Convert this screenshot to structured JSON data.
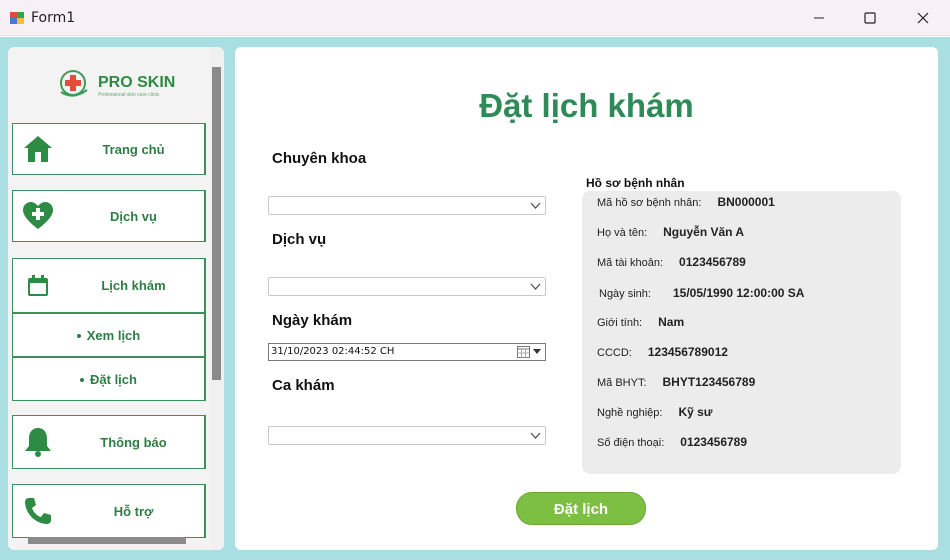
{
  "window": {
    "title": "Form1"
  },
  "logo": {
    "name": "PRO SKIN",
    "tagline": "Professional skin care clinic"
  },
  "sidebar": {
    "items": [
      {
        "label": "Trang chủ",
        "icon": "home-icon"
      },
      {
        "label": "Dịch vụ",
        "icon": "heart-plus-icon"
      },
      {
        "label": "Lịch khám",
        "icon": "calendar-icon"
      },
      {
        "label": "Xem lịch",
        "icon": ""
      },
      {
        "label": "Đặt lịch",
        "icon": ""
      },
      {
        "label": "Thông báo",
        "icon": "bell-icon"
      },
      {
        "label": "Hỗ trợ",
        "icon": "phone-icon"
      }
    ]
  },
  "main": {
    "title": "Đặt lịch khám",
    "fields": {
      "specialty_label": "Chuyên khoa",
      "specialty_value": "",
      "service_label": "Dịch vụ",
      "service_value": "",
      "date_label": "Ngày khám",
      "date_value": "31/10/2023 02:44:52 CH",
      "shift_label": "Ca khám",
      "shift_value": ""
    },
    "submit_label": "Đặt lịch"
  },
  "profile": {
    "heading": "Hồ sơ bệnh nhân",
    "rows": [
      {
        "key": "Mã hồ sơ bệnh nhân:",
        "value": "BN000001"
      },
      {
        "key": "Họ và tên:",
        "value": "Nguyễn Văn A"
      },
      {
        "key": "Mã tài khoản:",
        "value": "0123456789"
      },
      {
        "key": "Ngày sinh:",
        "value": "15/05/1990 12:00:00 SA"
      },
      {
        "key": "Giới tính:",
        "value": "Nam"
      },
      {
        "key": "CCCD:",
        "value": "123456789012"
      },
      {
        "key": "Mã BHYT:",
        "value": "BHYT123456789"
      },
      {
        "key": "Nghề nghiệp:",
        "value": "Kỹ sư"
      },
      {
        "key": "Số điện thoại:",
        "value": "0123456789"
      }
    ]
  },
  "colors": {
    "accent_green": "#2e8b57",
    "button_green": "#7cbf43",
    "frame_teal": "#a9dfe2"
  }
}
